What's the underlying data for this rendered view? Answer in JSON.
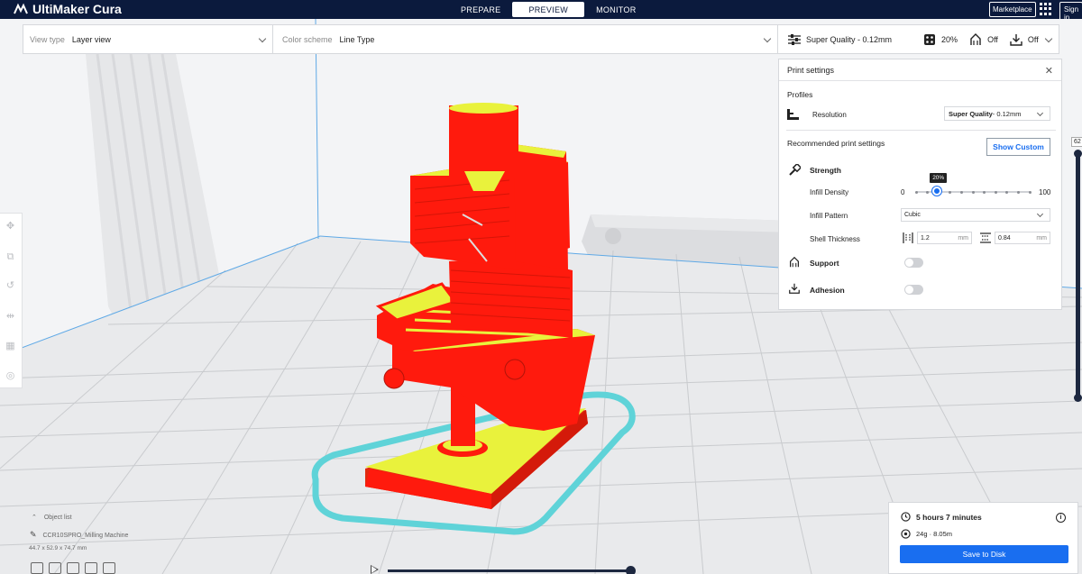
{
  "app": {
    "title": "UltiMaker Cura"
  },
  "stages": [
    "PREPARE",
    "PREVIEW",
    "MONITOR"
  ],
  "active_stage": "PREVIEW",
  "header": {
    "marketplace": "Marketplace",
    "signin": "Sign in"
  },
  "view": {
    "view_type_label": "View type",
    "view_type_value": "Layer view",
    "color_scheme_label": "Color scheme",
    "color_scheme_value": "Line Type"
  },
  "print_summary": {
    "profile": "Super Quality - 0.12mm",
    "infill": "20%",
    "support": "Off",
    "adhesion": "Off"
  },
  "print_settings": {
    "title": "Print settings",
    "profiles_label": "Profiles",
    "resolution_label": "Resolution",
    "resolution_value_bold": "Super Quality",
    "resolution_value_rest": " - 0.12mm",
    "recommended_label": "Recommended print settings",
    "show_custom": "Show Custom",
    "strength_label": "Strength",
    "infill_density_label": "Infill Density",
    "infill_min": "0",
    "infill_max": "100",
    "infill_value_label": "20%",
    "infill_value": 20,
    "infill_pattern_label": "Infill Pattern",
    "infill_pattern_value": "Cubic",
    "shell_thickness_label": "Shell Thickness",
    "wall_thickness": "1.2",
    "top_bottom_thickness": "0.84",
    "unit": "mm",
    "support_label": "Support",
    "adhesion_label": "Adhesion"
  },
  "object_list": {
    "header": "Object list",
    "object_name": "CCR10SPRO_Milling Machine",
    "dimensions": "44.7 x 52.9 x 74.7 mm"
  },
  "layer": {
    "current": "62"
  },
  "output": {
    "print_time": "5 hours 7 minutes",
    "material": "24g · 8.05m",
    "save_button": "Save to Disk"
  },
  "colors": {
    "header_bg": "#0b1a3d",
    "model_wall": "#ff1a0d",
    "model_infill": "#e9f23c",
    "skirt": "#5fd3d8",
    "accent": "#196ef0"
  },
  "icons": [
    "cura-logo-icon",
    "apps-grid-icon",
    "sliders-icon",
    "infill-icon",
    "support-icon",
    "adhesion-icon",
    "close-icon",
    "chevron-down-icon",
    "strength-icon",
    "clock-icon",
    "spool-icon",
    "info-icon",
    "move-icon",
    "scale-icon",
    "rotate-icon",
    "mirror-icon",
    "per-model-icon",
    "support-blocker-icon",
    "pencil-icon"
  ]
}
